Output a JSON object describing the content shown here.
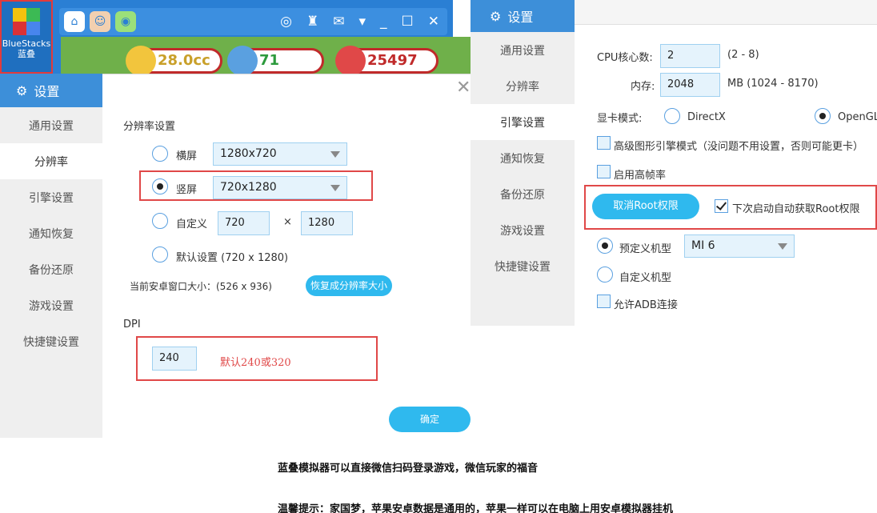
{
  "desktop_icon": {
    "line1": "BlueStacks",
    "line2": "蓝叠"
  },
  "game_bar": {
    "stat1": "28.0cc",
    "stat2": "71",
    "stat3": "25497"
  },
  "left_panel": {
    "title": "设置",
    "nav": [
      "通用设置",
      "分辨率",
      "引擎设置",
      "通知恢复",
      "备份还原",
      "游戏设置",
      "快捷键设置"
    ],
    "active_index": 1,
    "resolution_heading": "分辨率设置",
    "landscape_label": "横屏",
    "landscape_value": "1280x720",
    "portrait_label": "竖屏",
    "portrait_value": "720x1280",
    "custom_label": "自定义",
    "custom_width": "720",
    "custom_times": "×",
    "custom_height": "1280",
    "default_label": "默认设置 (720 x 1280)",
    "window_size": "当前安卓窗口大小：(526 x 936)",
    "restore_button": "恢复成分辨率大小",
    "dpi_heading": "DPI",
    "dpi_value": "240",
    "dpi_note": "默认240或320",
    "confirm_button": "确定",
    "close_glyph": "✕"
  },
  "right_panel": {
    "title": "设置",
    "nav": [
      "通用设置",
      "分辨率",
      "引擎设置",
      "通知恢复",
      "备份还原",
      "游戏设置",
      "快捷键设置"
    ],
    "active_index": 2,
    "cpu_label": "CPU核心数:",
    "cpu_value": "2",
    "cpu_range": "(2 - 8)",
    "mem_label": "内存:",
    "mem_value": "2048",
    "mem_range": "MB   (1024 - 8170)",
    "gpu_label": "显卡模式:",
    "gpu_directx": "DirectX",
    "gpu_opengl": "OpenGL",
    "advanced_label": "高级图形引擎模式（没问题不用设置，否则可能更卡）",
    "high_fps_label": "启用高帧率",
    "root_button": "取消Root权限",
    "auto_root_label": "下次启动自动获取Root权限",
    "preset_label": "预定义机型",
    "preset_value": "MI 6",
    "custom_model_label": "自定义机型",
    "adb_label": "允许ADB连接"
  },
  "caption1": "蓝叠模拟器可以直接微信扫码登录游戏，微信玩家的福音",
  "caption2": "温馨提示：家国梦，苹果安卓数据是通用的，苹果一样可以在电脑上用安卓模拟器挂机"
}
